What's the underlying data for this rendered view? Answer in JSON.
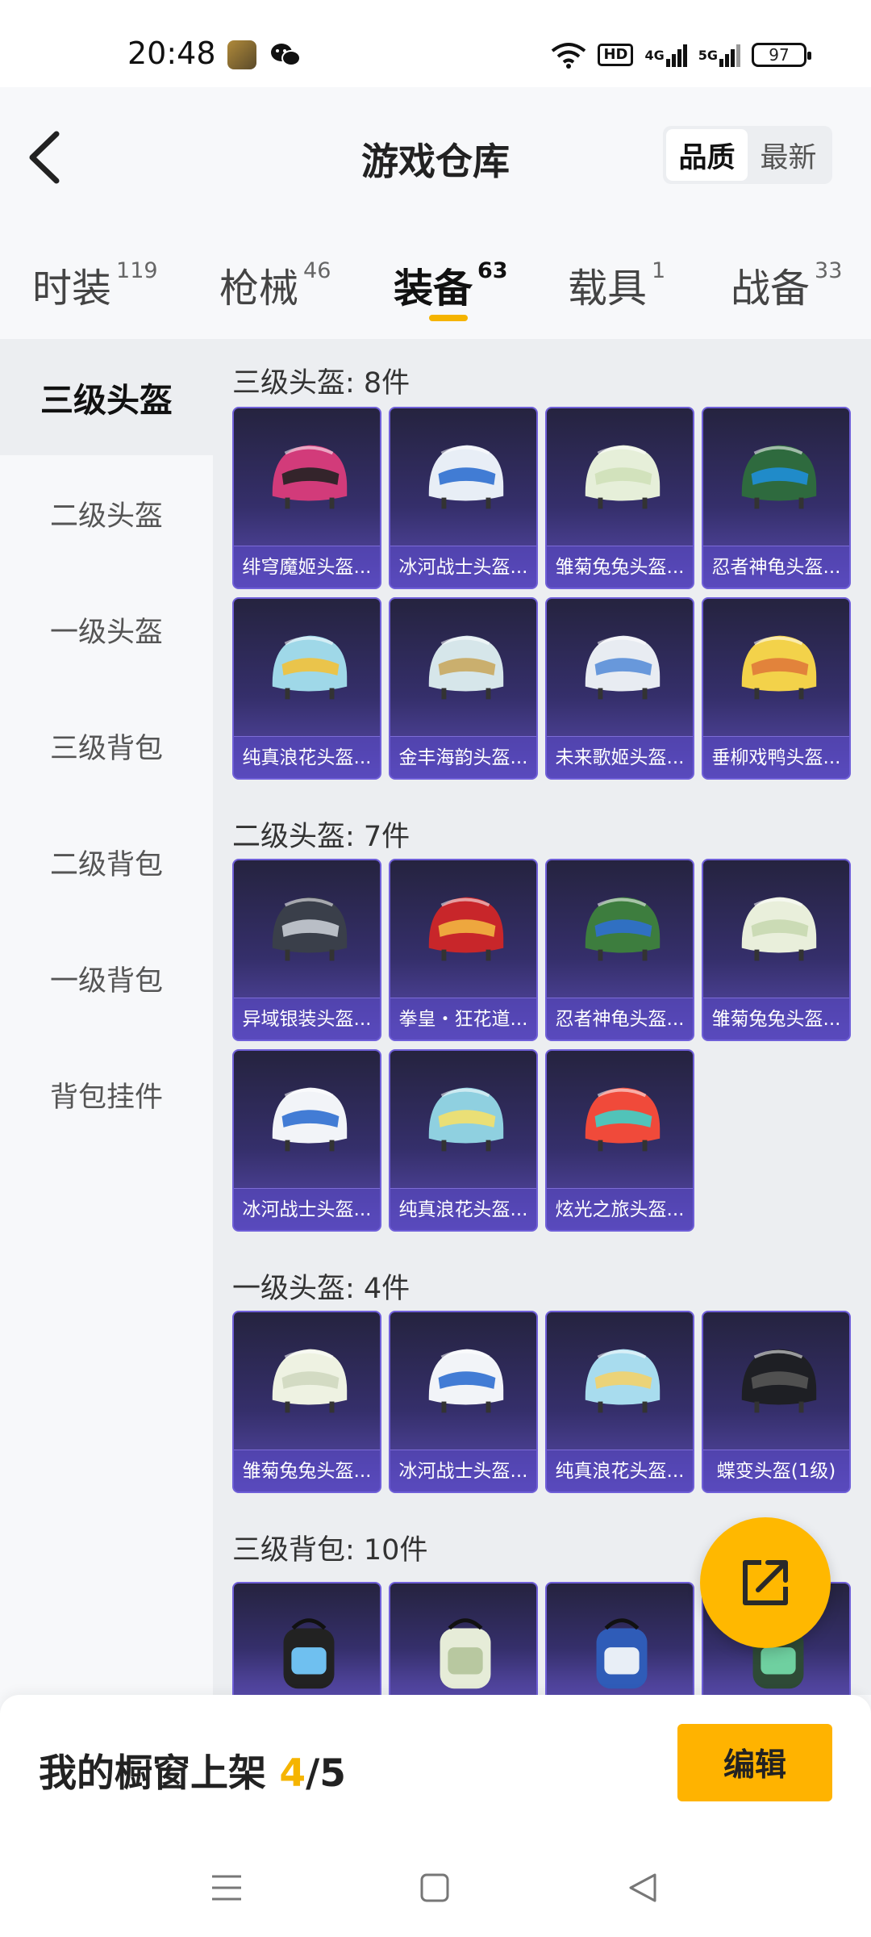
{
  "status_bar": {
    "time": "20:48",
    "hd_label": "HD",
    "signal1": "4G",
    "signal2": "5G",
    "battery": "97"
  },
  "header": {
    "title": "游戏仓库",
    "sort_options": [
      "品质",
      "最新"
    ],
    "sort_active": "品质"
  },
  "tabs": [
    {
      "label": "时装",
      "count": "119"
    },
    {
      "label": "枪械",
      "count": "46"
    },
    {
      "label": "装备",
      "count": "63",
      "active": true
    },
    {
      "label": "载具",
      "count": "1"
    },
    {
      "label": "战备",
      "count": "33"
    }
  ],
  "categories": [
    "三级头盔",
    "二级头盔",
    "一级头盔",
    "三级背包",
    "二级背包",
    "一级背包",
    "背包挂件"
  ],
  "sections": [
    {
      "title": "三级头盔: 8件",
      "items": [
        "绯穹魔姬头盔...",
        "冰河战士头盔...",
        "雏菊兔兔头盔...",
        "忍者神龟头盔...",
        "纯真浪花头盔...",
        "金丰海韵头盔...",
        "未来歌姬头盔...",
        "垂柳戏鸭头盔..."
      ]
    },
    {
      "title": "二级头盔: 7件",
      "items": [
        "异域银装头盔...",
        "拳皇・狂花道...",
        "忍者神龟头盔...",
        "雏菊兔兔头盔...",
        "冰河战士头盔...",
        "纯真浪花头盔...",
        "炫光之旅头盔..."
      ]
    },
    {
      "title": "一级头盔: 4件",
      "items": [
        "雏菊兔兔头盔...",
        "冰河战士头盔...",
        "纯真浪花头盔...",
        "蝶变头盔(1级)"
      ]
    },
    {
      "title": "三级背包: 10件",
      "items": [
        "",
        "",
        "",
        ""
      ]
    }
  ],
  "bottom": {
    "showcase_prefix": "我的橱窗上架 ",
    "showcase_current": "4",
    "showcase_total": "/5",
    "edit_label": "编辑"
  },
  "colors": {
    "accent": "#FFB800",
    "card_top": "#25233F",
    "card_bottom": "#5A4CB0"
  }
}
